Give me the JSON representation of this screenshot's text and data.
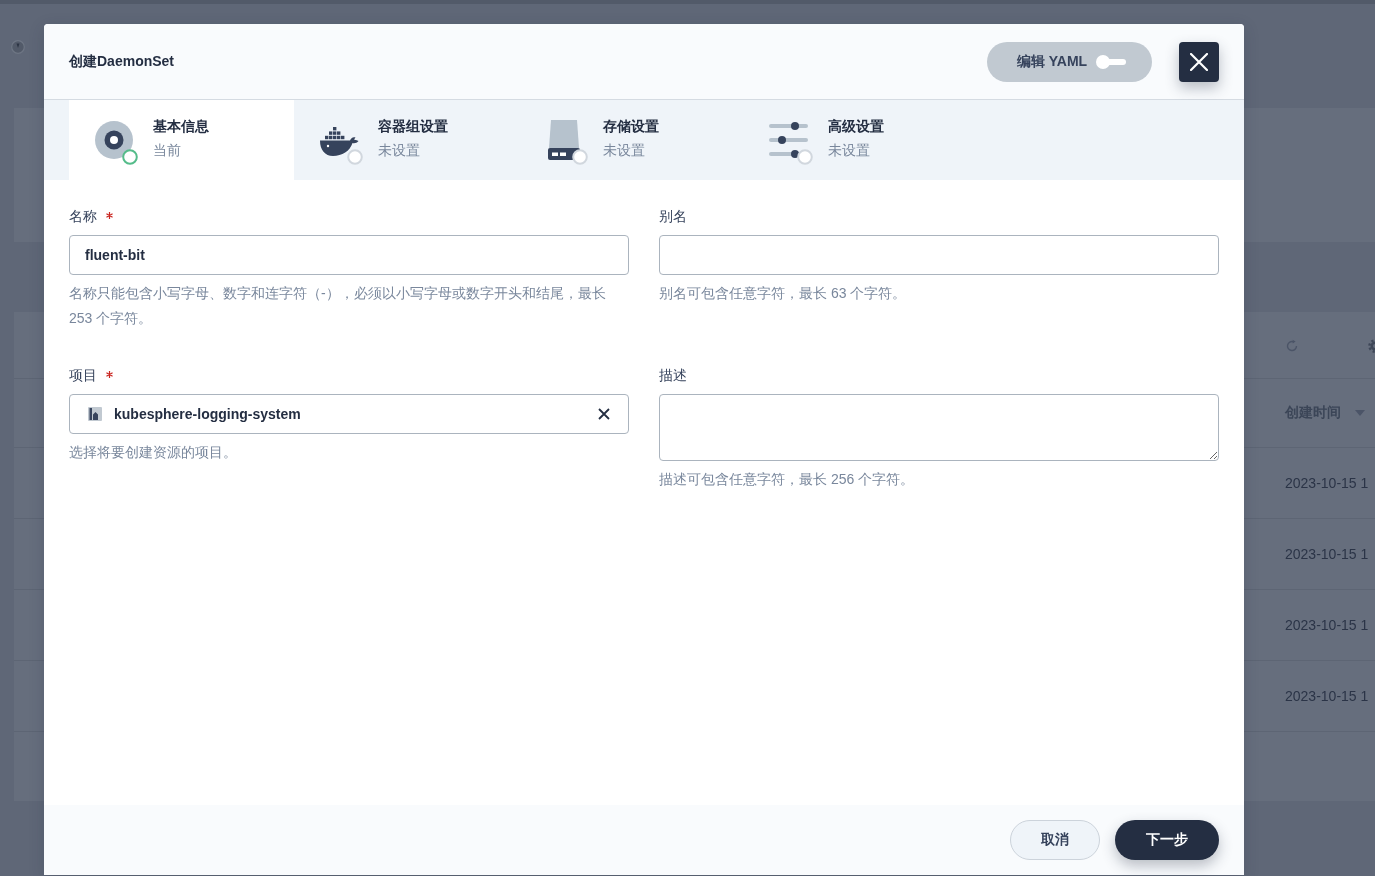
{
  "background": {
    "table": {
      "column_header": "创建时间",
      "rows": [
        {
          "created": "2023-10-15 1"
        },
        {
          "created": "2023-10-15 1"
        },
        {
          "created": "2023-10-15 1"
        },
        {
          "created": "2023-10-15 1"
        }
      ]
    }
  },
  "dialog": {
    "title": "创建DaemonSet",
    "yaml_switch": {
      "label": "编辑 YAML",
      "on": false
    },
    "steps": [
      {
        "title": "基本信息",
        "status": "当前",
        "selected": true,
        "kind": "basic"
      },
      {
        "title": "容器组设置",
        "status": "未设置",
        "selected": false,
        "kind": "containers"
      },
      {
        "title": "存储设置",
        "status": "未设置",
        "selected": false,
        "kind": "storage"
      },
      {
        "title": "高级设置",
        "status": "未设置",
        "selected": false,
        "kind": "advanced"
      }
    ],
    "fields": [
      {
        "label": "名称",
        "required": true,
        "kind": "input",
        "value": "fluent-bit",
        "hint": "名称只能包含小写字母、数字和连字符（-），必须以小写字母或数字开头和结尾，最长 253 个字符。"
      },
      {
        "label": "别名",
        "required": false,
        "kind": "input",
        "hint": "别名可包含任意字符，最长 63 个字符。"
      },
      {
        "label": "项目",
        "required": true,
        "kind": "select",
        "value": "kubesphere-logging-system",
        "hint": "选择将要创建资源的项目。"
      },
      {
        "label": "描述",
        "required": false,
        "kind": "textarea",
        "hint": "描述可包含任意字符，最长 256 个字符。"
      }
    ],
    "buttons": [
      {
        "label": "取消",
        "kind": "secondary"
      },
      {
        "label": "下一步",
        "kind": "primary"
      }
    ]
  }
}
